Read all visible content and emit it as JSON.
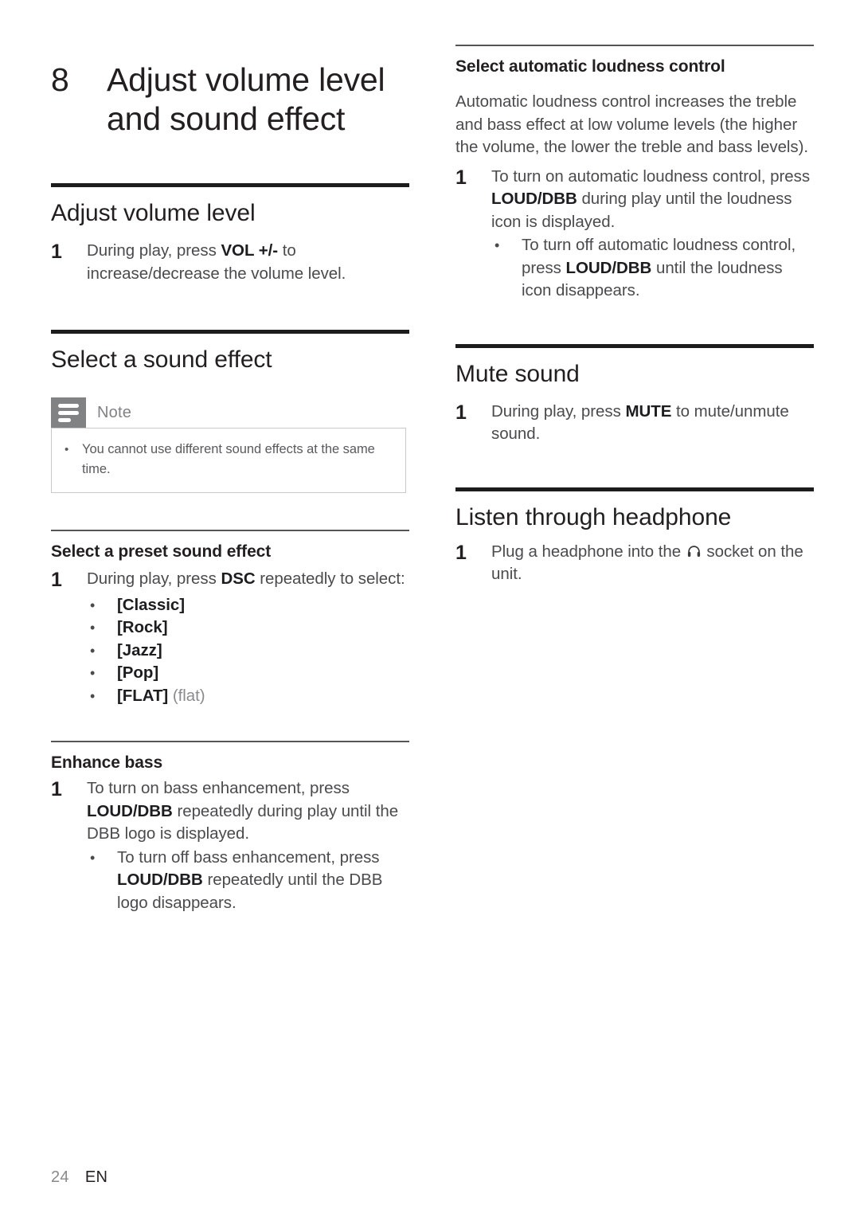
{
  "chapter": {
    "number": "8",
    "title": "Adjust volume level and sound effect"
  },
  "left_column": {
    "section_volume": {
      "heading": "Adjust volume level",
      "step_number": "1",
      "step_pre": "During play, press ",
      "step_kw": "VOL +/-",
      "step_post": " to increase/decrease the volume level."
    },
    "section_sound_effect": {
      "heading": "Select a sound effect",
      "note": {
        "title": "Note",
        "bullet": "•",
        "text": "You cannot use different sound effects at the same time."
      },
      "preset": {
        "heading": "Select a preset sound effect",
        "step_number": "1",
        "step_pre": "During play, press ",
        "step_kw": "DSC",
        "step_post": " repeatedly to select:",
        "bullet": "•",
        "options": [
          {
            "label": "[Classic]",
            "note": ""
          },
          {
            "label": "[Rock]",
            "note": ""
          },
          {
            "label": "[Jazz]",
            "note": ""
          },
          {
            "label": "[Pop]",
            "note": ""
          },
          {
            "label": "[FLAT]",
            "note": " (flat)"
          }
        ]
      },
      "bass": {
        "heading": "Enhance bass",
        "step_number": "1",
        "step_pre": "To turn on bass enhancement, press ",
        "step_kw": "LOUD/DBB",
        "step_post": " repeatedly during play until the DBB logo is displayed.",
        "bullet": "•",
        "sub_pre": "To turn off bass enhancement, press ",
        "sub_kw": "LOUD/DBB",
        "sub_post": " repeatedly until the DBB logo disappears."
      }
    }
  },
  "right_column": {
    "section_loudness": {
      "heading": "Select automatic loudness control",
      "paragraph": "Automatic loudness control increases the treble and bass effect at low volume levels (the higher the volume, the lower the treble and bass levels).",
      "step_number": "1",
      "step_pre": "To turn on automatic loudness control, press ",
      "step_kw": "LOUD/DBB",
      "step_post": " during play until the loudness icon is displayed.",
      "bullet": "•",
      "sub_pre": "To turn off automatic loudness control, press ",
      "sub_kw": "LOUD/DBB",
      "sub_post": " until the loudness icon disappears."
    },
    "section_mute": {
      "heading": "Mute sound",
      "step_number": "1",
      "step_pre": "During play, press ",
      "step_kw": "MUTE",
      "step_post": " to mute/unmute sound."
    },
    "section_headphone": {
      "heading": "Listen through headphone",
      "step_number": "1",
      "step_pre": "Plug a headphone into the ",
      "step_icon": "headphones-icon",
      "step_post": " socket on the unit."
    }
  },
  "footer": {
    "page_number": "24",
    "language": "EN"
  }
}
